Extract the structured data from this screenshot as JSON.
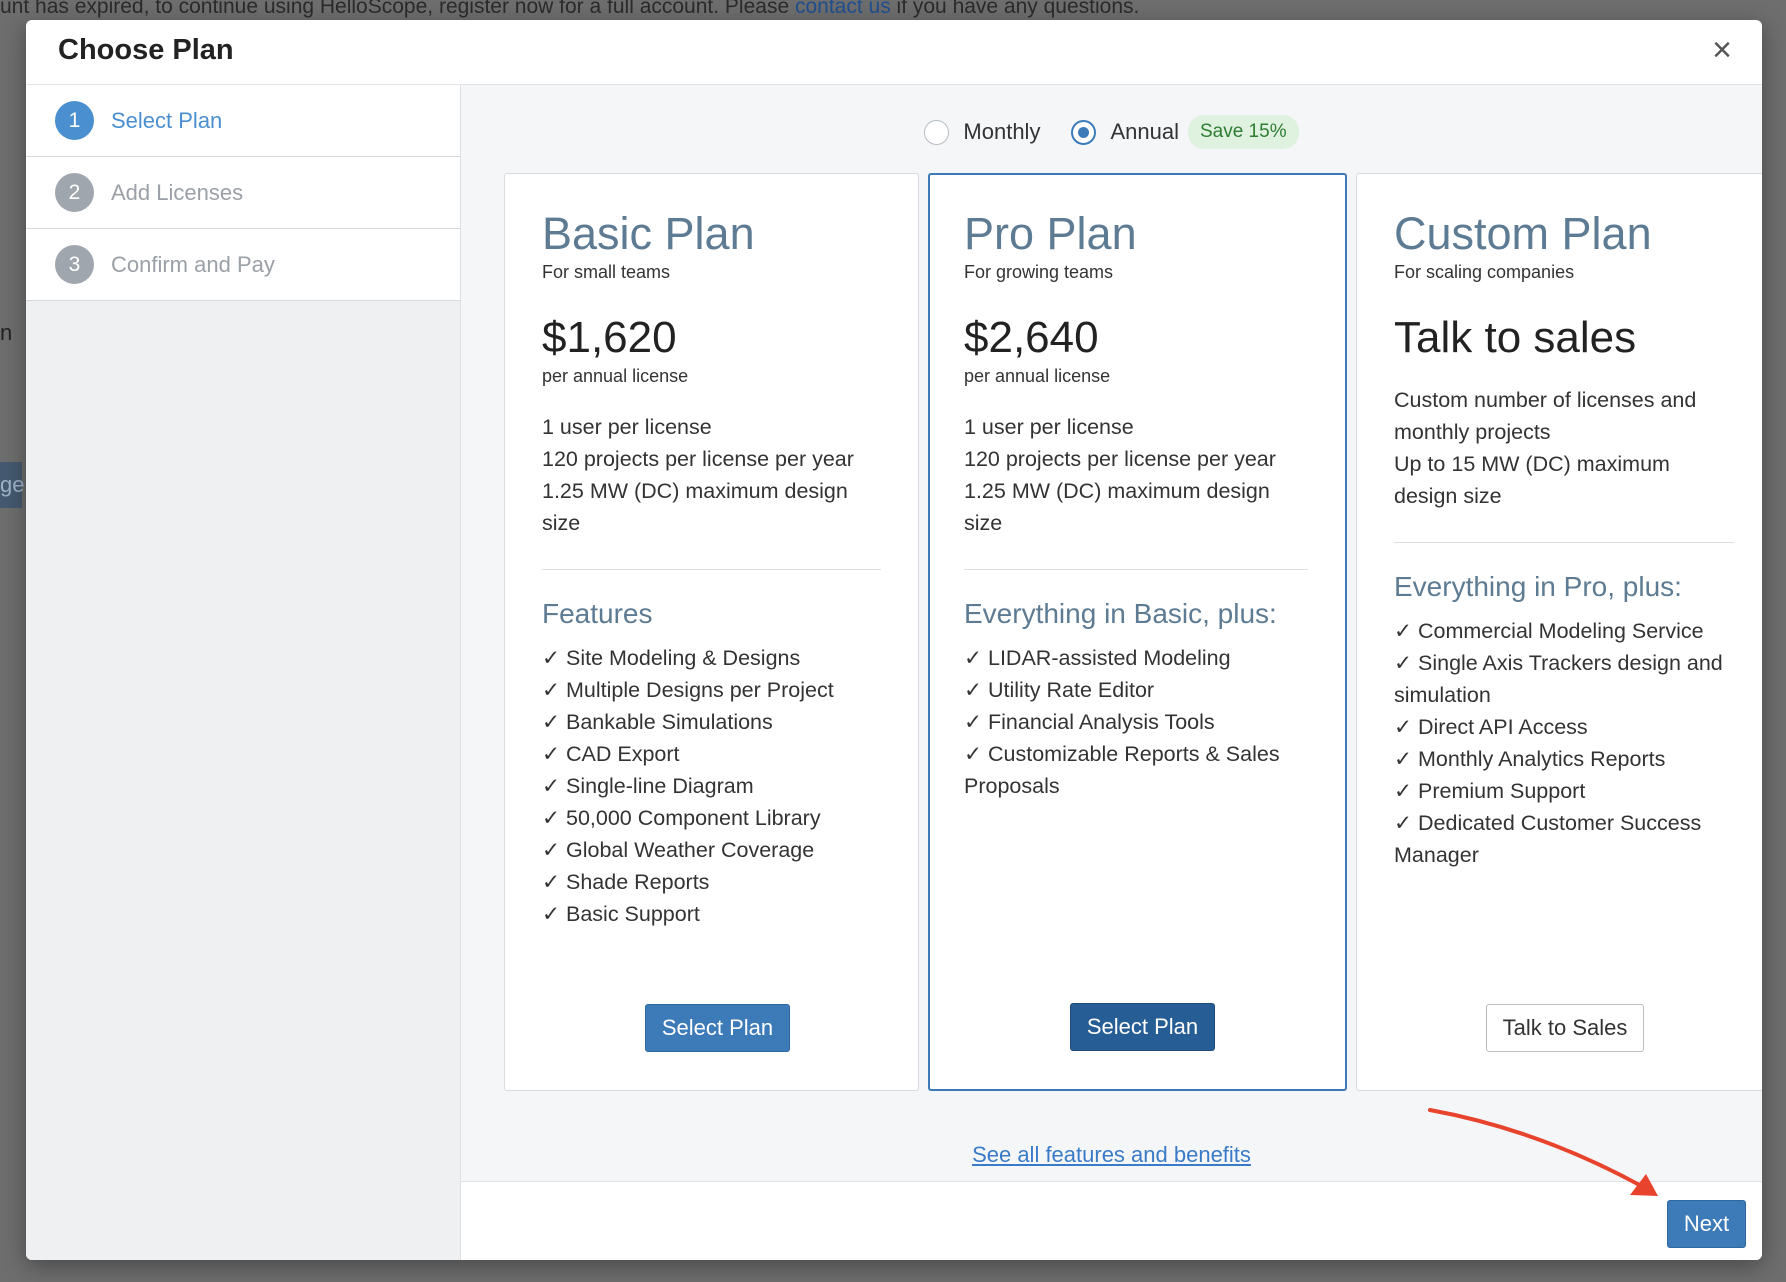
{
  "background": {
    "banner_text": "unt has expired, to continue using HelloScope, register now for a full account. Please ",
    "banner_link": "contact us",
    "banner_tail": " if you have any questions.",
    "fragment_n": "n",
    "fragment_ge": "ge"
  },
  "modal": {
    "title": "Choose Plan",
    "close_glyph": "×"
  },
  "steps": [
    {
      "num": "1",
      "label": "Select Plan",
      "active": true
    },
    {
      "num": "2",
      "label": "Add Licenses",
      "active": false
    },
    {
      "num": "3",
      "label": "Confirm and Pay",
      "active": false
    }
  ],
  "billing": {
    "monthly_label": "Monthly",
    "annual_label": "Annual",
    "save_badge": "Save 15%",
    "selected": "Annual"
  },
  "plans": [
    {
      "name": "Basic Plan",
      "subtitle": "For small teams",
      "price": "$1,620",
      "price_unit": "per annual license",
      "specs": [
        "1 user per license",
        "120 projects per license per year",
        "1.25 MW (DC) maximum design size"
      ],
      "features_title": "Features",
      "features": [
        "Site Modeling & Designs",
        "Multiple Designs per Project",
        "Bankable Simulations",
        "CAD Export",
        "Single-line Diagram",
        "50,000 Component Library",
        "Global Weather Coverage",
        "Shade Reports",
        "Basic Support"
      ],
      "button": "Select Plan"
    },
    {
      "name": "Pro Plan",
      "subtitle": "For growing teams",
      "price": "$2,640",
      "price_unit": "per annual license",
      "specs": [
        "1 user per license",
        "120 projects per license per year",
        "1.25 MW (DC) maximum design size"
      ],
      "features_title": "Everything in Basic, plus:",
      "features": [
        "LIDAR-assisted Modeling",
        "Utility Rate Editor",
        "Financial Analysis Tools",
        "Customizable Reports & Sales Proposals"
      ],
      "button": "Select Plan"
    },
    {
      "name": "Custom Plan",
      "subtitle": "For scaling companies",
      "price": "Talk to sales",
      "specs": [
        "Custom number of licenses and monthly projects",
        "Up to 15 MW (DC) maximum design size"
      ],
      "features_title": "Everything in Pro, plus:",
      "features": [
        "Commercial Modeling Service",
        "Single Axis Trackers design and simulation",
        "Direct API Access",
        "Monthly Analytics Reports",
        "Premium Support",
        "Dedicated Customer Success Manager"
      ],
      "button": "Talk to Sales"
    }
  ],
  "see_all_link": "See all features and benefits",
  "footer": {
    "next_label": "Next"
  },
  "colors": {
    "accent": "#3d7ab8",
    "annotation_arrow": "#e8432c"
  }
}
